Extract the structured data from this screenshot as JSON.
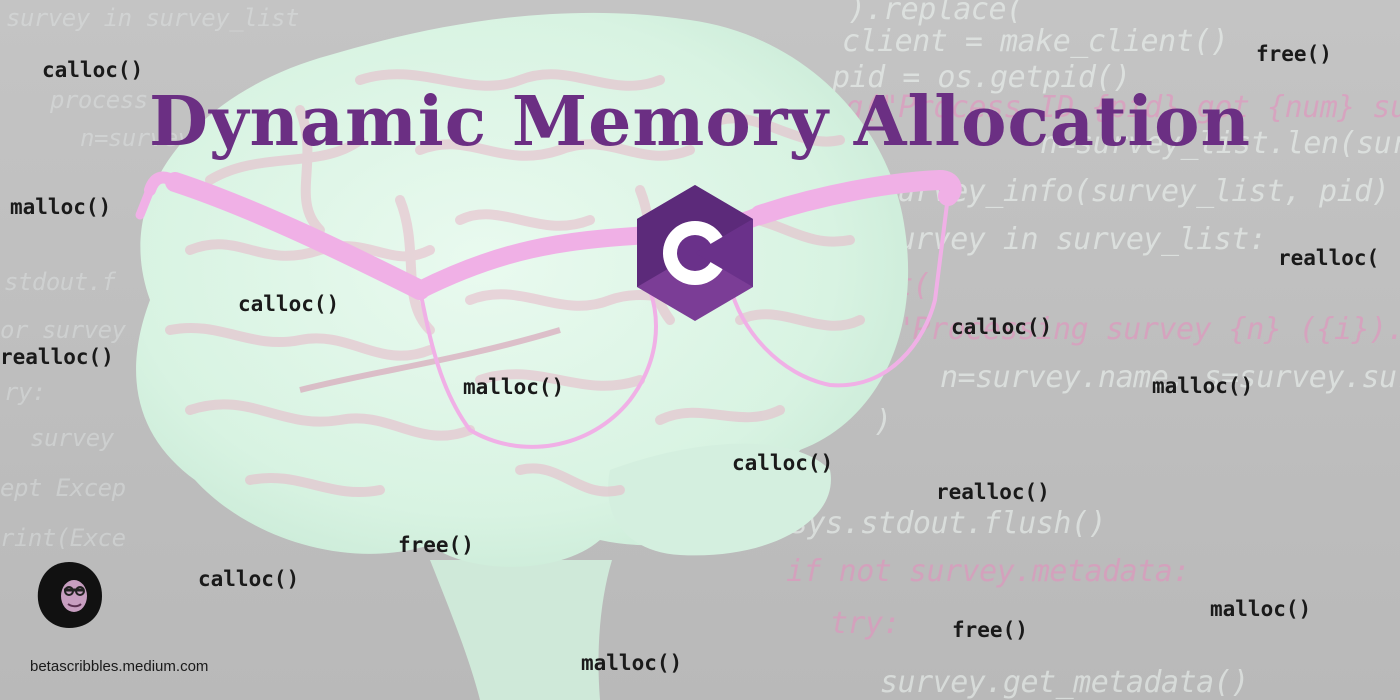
{
  "title": "Dynamic Memory Allocation",
  "footer_url": "betascribbles.medium.com",
  "colors": {
    "title": "#6b2f83",
    "glasses": "#f0b0e6",
    "c_logo_dark": "#5c2a7a",
    "c_logo_light": "#7b3d96",
    "brain_tint": "#dff7ea",
    "background": "#bdbdbd"
  },
  "icons": [
    "brain-illustration",
    "glasses-illustration",
    "c-language-logo-icon",
    "author-avatar-icon"
  ],
  "function_labels": [
    "calloc()",
    "free()",
    "malloc()",
    "realloc(",
    "calloc()",
    "realloc()",
    "calloc()",
    "malloc()",
    "malloc()",
    "calloc()",
    "realloc()",
    "free()",
    "calloc()",
    "malloc()",
    "free()",
    "malloc()"
  ],
  "background_code": [
    ").replace(",
    "client = make_client()",
    "pid = os.getpid()",
    "sg(\"Process ID {pid} got {num} surve",
    "n=survey_list.len(survey",
    "survey_info(survey_list, pid)",
    "survey in survey_list:",
    "int(",
    "\"Processing survey {n} ({i})...\"",
    "n=survey.name, s=survey.surv",
    ")",
    "sys.stdout.flush()",
    "if not survey.metadata:",
    "try:",
    "survey.get_metadata()",
    "survey in survey_list",
    "process",
    "n=survey",
    "stdout.f",
    "or survey",
    "ry:",
    "survey",
    "ept Excep",
    "rint(Exce"
  ]
}
